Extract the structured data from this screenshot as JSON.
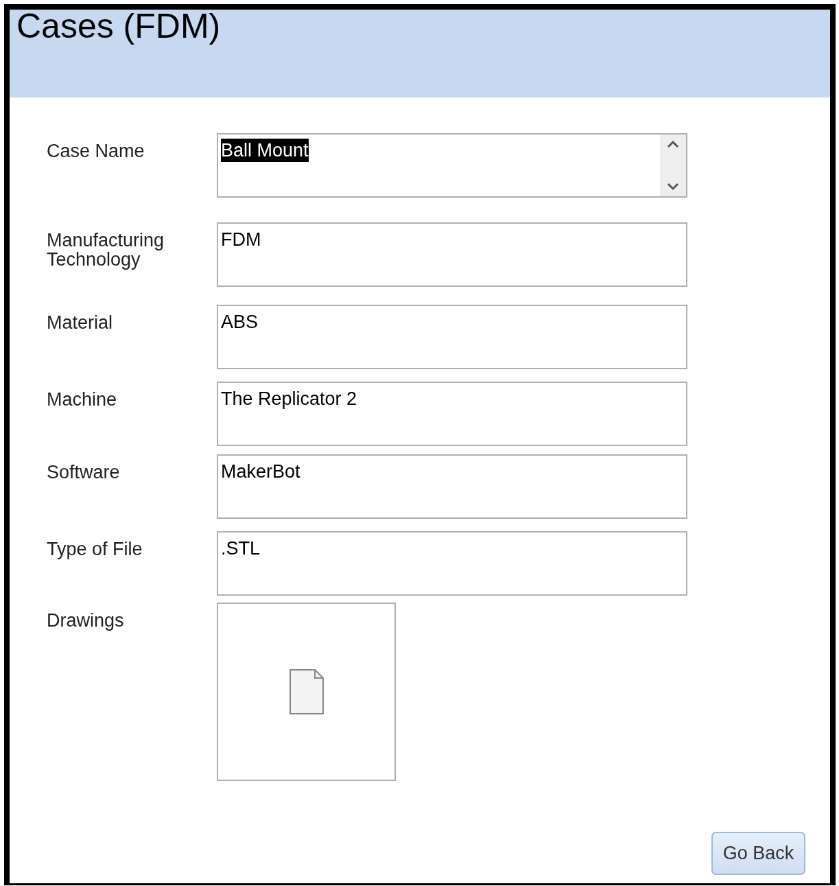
{
  "form": {
    "title": "Cases (FDM)"
  },
  "fields": [
    {
      "kind": "scrolling",
      "label": "Case Name",
      "value": "Ball Mount",
      "text_selected": true
    },
    {
      "kind": "text",
      "label": "Manufacturing Technology",
      "value": "FDM",
      "text_selected": false
    },
    {
      "kind": "text",
      "label": "Material",
      "value": "ABS",
      "text_selected": false
    },
    {
      "kind": "text",
      "label": "Machine",
      "value": "The Replicator 2",
      "text_selected": false
    },
    {
      "kind": "text",
      "label": "Software",
      "value": "MakerBot",
      "text_selected": false
    },
    {
      "kind": "text",
      "label": "Type of File",
      "value": ".STL",
      "text_selected": false
    },
    {
      "kind": "attachment",
      "label": "Drawings"
    }
  ],
  "buttons": [
    {
      "label": "Go Back"
    }
  ]
}
